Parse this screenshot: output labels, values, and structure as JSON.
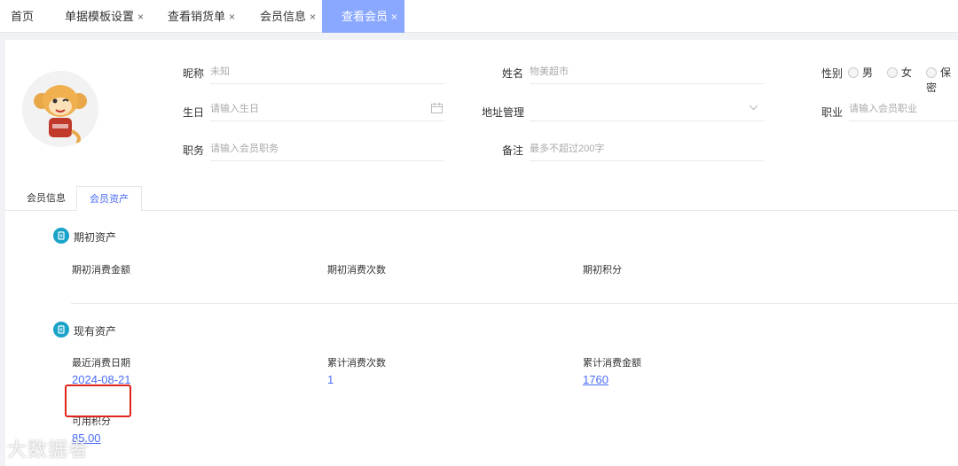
{
  "tabs": [
    {
      "label": "首页",
      "closable": false
    },
    {
      "label": "单据模板设置",
      "closable": true
    },
    {
      "label": "查看销货单",
      "closable": true
    },
    {
      "label": "会员信息",
      "closable": true
    },
    {
      "label": "查看会员",
      "closable": true,
      "active": true
    }
  ],
  "close_glyph": "×",
  "form": {
    "nickname": {
      "label": "昵称",
      "value": "未知"
    },
    "name": {
      "label": "姓名",
      "value": "物美超市"
    },
    "gender": {
      "label": "性别",
      "options": [
        "男",
        "女",
        "保密"
      ]
    },
    "birthday": {
      "label": "生日",
      "placeholder": "请输入生日"
    },
    "address": {
      "label": "地址管理",
      "value": ""
    },
    "occupation": {
      "label": "职业",
      "placeholder": "请输入会员职业"
    },
    "position": {
      "label": "职务",
      "placeholder": "请输入会员职务"
    },
    "remark": {
      "label": "备注",
      "placeholder": "最多不超过200字"
    }
  },
  "subtabs": [
    {
      "label": "会员信息"
    },
    {
      "label": "会员资产",
      "active": true
    }
  ],
  "initial_assets": {
    "title": "期初资产",
    "items": [
      {
        "label": "期初消费金额",
        "value": ""
      },
      {
        "label": "期初消费次数",
        "value": ""
      },
      {
        "label": "期初积分",
        "value": ""
      }
    ]
  },
  "current_assets": {
    "title": "现有资产",
    "items": [
      {
        "label": "最近消费日期",
        "value": "2024-08-21"
      },
      {
        "label": "累计消费次数",
        "value": "1"
      },
      {
        "label": "累计消费金额",
        "value": "1760"
      },
      {
        "label": "可用积分",
        "value": "85.00"
      }
    ]
  },
  "watermark": "大数据者",
  "colors": {
    "accent": "#4a6cf7",
    "active_tab": "#8aa8ff",
    "section_icon": "#1aa3c9",
    "highlight": "#e0241b"
  }
}
